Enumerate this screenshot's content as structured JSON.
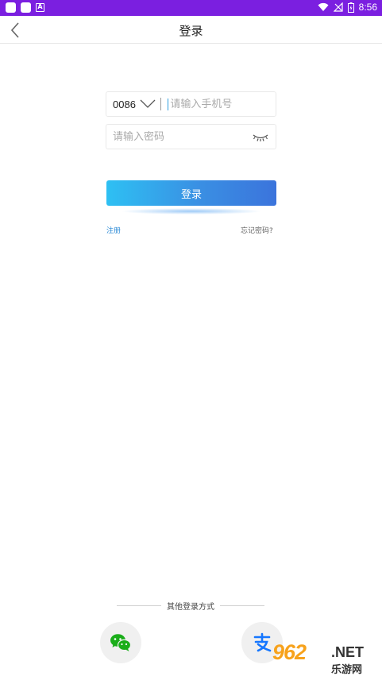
{
  "status_bar": {
    "time": "8:56"
  },
  "header": {
    "title": "登录"
  },
  "form": {
    "country_code": "0086",
    "phone_placeholder": "请输入手机号",
    "password_placeholder": "请输入密码",
    "login_label": "登录",
    "register_label": "注册",
    "forgot_label": "忘记密码?"
  },
  "other_login": {
    "label": "其他登录方式",
    "providers": [
      {
        "icon": "wechat-icon",
        "color": "#1aad19"
      },
      {
        "icon": "alipay-icon",
        "color": "#1677ff"
      }
    ]
  },
  "watermark": {
    "number": "962",
    "domain": ".NET",
    "name": "乐游网"
  },
  "colors": {
    "status_bar": "#7b1fe0",
    "accent_start": "#2ec0f3",
    "accent_end": "#3b74dc",
    "link": "#2a8ad6"
  }
}
